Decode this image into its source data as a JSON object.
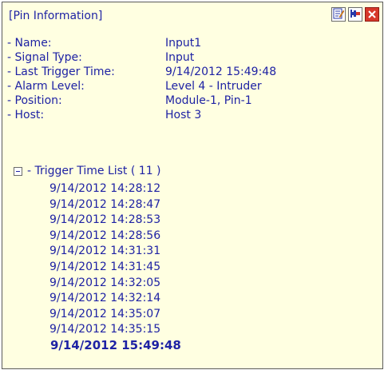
{
  "panel": {
    "title": "[Pin Information]",
    "toolbar": {
      "buttons": [
        {
          "name": "edit",
          "icon": "edit-note-icon"
        },
        {
          "name": "pin",
          "icon": "pin-icon"
        },
        {
          "name": "close",
          "icon": "close-icon"
        }
      ]
    }
  },
  "info": [
    {
      "label": "- Name:",
      "value": "Input1"
    },
    {
      "label": "- Signal Type:",
      "value": "Input"
    },
    {
      "label": "- Last Trigger Time:",
      "value": "9/14/2012 15:49:48"
    },
    {
      "label": "- Alarm Level:",
      "value": "Level 4 - Intruder"
    },
    {
      "label": "- Position:",
      "value": "Module-1, Pin-1"
    },
    {
      "label": "- Host:",
      "value": "Host 3"
    }
  ],
  "trigger_list": {
    "header": "- Trigger Time List ( 11 )",
    "expanded": true,
    "items": [
      "9/14/2012 14:28:12",
      "9/14/2012 14:28:47",
      "9/14/2012 14:28:53",
      "9/14/2012 14:28:56",
      "9/14/2012 14:31:31",
      "9/14/2012 14:31:45",
      "9/14/2012 14:32:05",
      "9/14/2012 14:32:14",
      "9/14/2012 14:35:07",
      "9/14/2012 14:35:15",
      "9/14/2012 15:49:48"
    ]
  },
  "colors": {
    "text": "#1e22a4",
    "panel_background": "#ffffe1",
    "close_button": "#d7382a"
  }
}
